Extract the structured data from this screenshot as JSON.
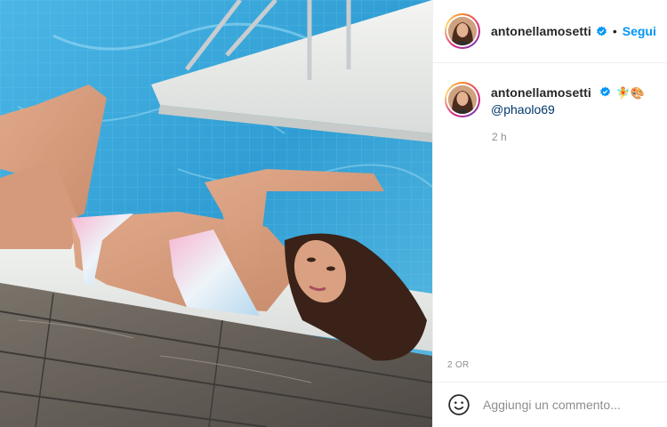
{
  "post": {
    "author": {
      "username": "antonellamosetti",
      "verified": true,
      "verified_color": "#0095f6"
    },
    "header": {
      "separator": "•",
      "follow_label": "Segui",
      "follow_color": "#0095f6"
    },
    "caption": {
      "username": "antonellamosetti",
      "emojis": "🧚🎨",
      "mention": "@phaolo69",
      "time_ago": "2 h"
    },
    "date_label": "2 OR",
    "add_comment": {
      "placeholder": "Aggiungi un commento..."
    }
  },
  "image": {
    "description_icon": "photo",
    "palette": {
      "pool_water": "#3aa6d8",
      "pool_edge": "#e9ecea",
      "deck_wood": "#6b6660"
    }
  }
}
